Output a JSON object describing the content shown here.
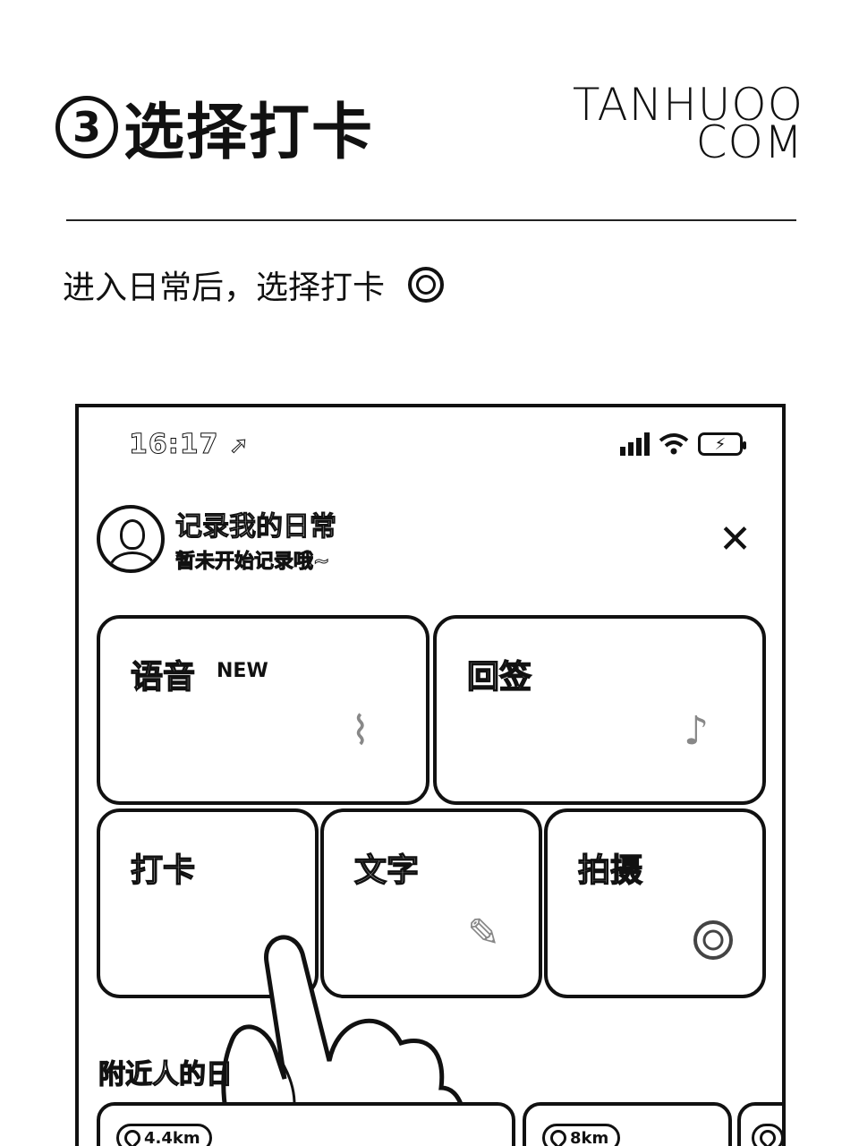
{
  "header": {
    "step_number": "3",
    "step_title": "选择打卡",
    "brand_line1": "TANHUOO",
    "brand_line2": "COM",
    "caption": "进入日常后，选择打卡"
  },
  "phone": {
    "status": {
      "time": "16:17",
      "location_arrow": "➚",
      "battery_symbol": "⚡"
    },
    "profile": {
      "title": "记录我的日常",
      "subtitle": "暂未开始记录哦~",
      "close_symbol": "✕"
    },
    "cards": {
      "voice": {
        "label": "语音",
        "badge": "NEW"
      },
      "recall": {
        "label": "回签"
      },
      "checkin": {
        "label": "打卡"
      },
      "text": {
        "label": "文字"
      },
      "photo": {
        "label": "拍摄"
      }
    },
    "nearby": {
      "title": "附近人的日",
      "items": [
        {
          "distance": "4.4km"
        },
        {
          "distance": "8km"
        },
        {
          "distance": ""
        }
      ]
    }
  },
  "icons": [
    "circled-three-icon",
    "ring-icon",
    "signal-icon",
    "wifi-icon",
    "battery-icon",
    "location-arrow-icon",
    "close-icon",
    "pin-icon",
    "avatar-icon",
    "hand-pointer-icon"
  ]
}
